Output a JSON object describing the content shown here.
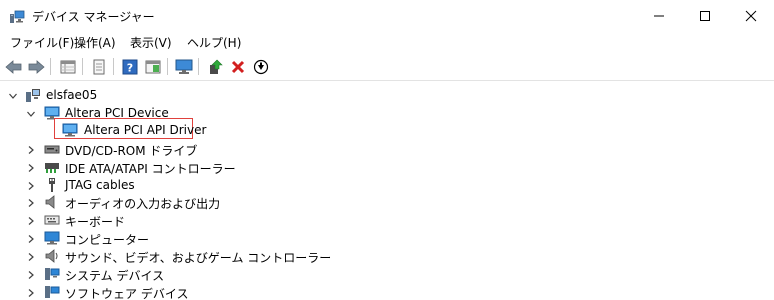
{
  "window": {
    "title": "デバイス マネージャー"
  },
  "menu": {
    "items": [
      "ファイル(F)",
      "操作(A)",
      "表示(V)",
      "ヘルプ(H)"
    ]
  },
  "toolbar": {
    "buttons": [
      "back-arrow-icon",
      "forward-arrow-icon",
      "properties-grid-icon",
      "document-icon",
      "help-icon",
      "view-panel-icon",
      "monitor-scan-icon",
      "update-driver-icon",
      "uninstall-x-icon",
      "disable-down-icon"
    ]
  },
  "tree": {
    "root": "elsfae05",
    "expanded_category": "Altera PCI Device",
    "selected_device": "Altera PCI API Driver",
    "categories": [
      "DVD/CD-ROM ドライブ",
      "IDE ATA/ATAPI コントローラー",
      "JTAG cables",
      "オーディオの入力および出力",
      "キーボード",
      "コンピューター",
      "サウンド、ビデオ、およびゲーム コントローラー",
      "システム デバイス",
      "ソフトウェア デバイス"
    ]
  },
  "colors": {
    "highlight_border": "#e0413d",
    "monitor_blue": "#1e78c8"
  }
}
